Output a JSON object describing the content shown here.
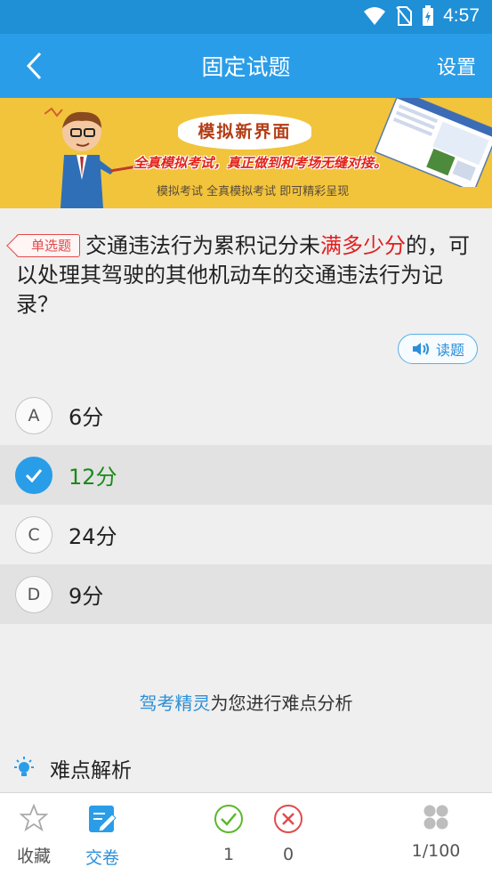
{
  "status_bar": {
    "time": "4:57"
  },
  "app_bar": {
    "title": "固定试题",
    "settings_label": "设置"
  },
  "banner": {
    "title": "模拟新界面",
    "subtitle": "全真模拟考试，真正做到和考场无缝对接。",
    "tagline": "模拟考试 全真模拟考试 即可精彩呈现"
  },
  "question": {
    "type_badge": "单选题",
    "text_before": "交通违法行为累积记分未",
    "text_highlight": "满多少分",
    "text_after": "的，可以处理其驾驶的其他机动车的交通违法行为记录？",
    "read_label": "读题"
  },
  "options": [
    {
      "letter": "A",
      "text": "6分",
      "selected": false
    },
    {
      "letter": "B",
      "text": "12分",
      "selected": true
    },
    {
      "letter": "C",
      "text": "24分",
      "selected": false
    },
    {
      "letter": "D",
      "text": "9分",
      "selected": false
    }
  ],
  "analysis": {
    "brand": "驾考精灵",
    "text": "为您进行难点分析"
  },
  "difficulty": {
    "title": "难点解析"
  },
  "bottom_bar": {
    "favorite_label": "收藏",
    "submit_label": "交卷",
    "correct_count": "1",
    "wrong_count": "0",
    "progress": "1/100"
  },
  "colors": {
    "primary": "#2a9de8",
    "correct": "#1a8a1a",
    "wrong": "#e24a4a",
    "highlight": "#e21d1d"
  }
}
